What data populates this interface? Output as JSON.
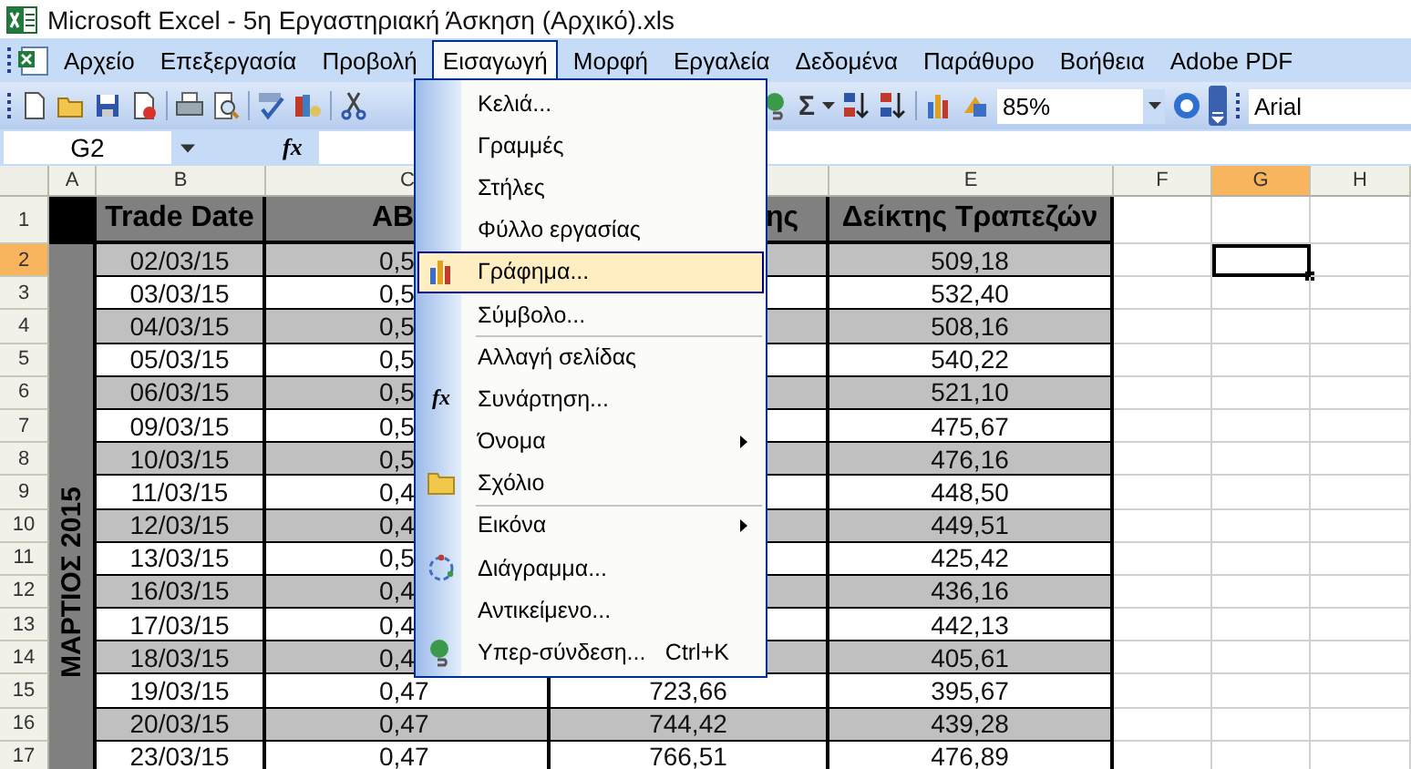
{
  "window": {
    "title": "Microsoft Excel - 5η Εργαστηριακή Άσκηση (Αρχικό).xls"
  },
  "menu_bar": [
    {
      "label": "Αρχείο",
      "selected": false
    },
    {
      "label": "Επεξεργασία",
      "selected": false
    },
    {
      "label": "Προβολή",
      "selected": false
    },
    {
      "label": "Εισαγωγή",
      "selected": true
    },
    {
      "label": "Μορφή",
      "selected": false
    },
    {
      "label": "Εργαλεία",
      "selected": false
    },
    {
      "label": "Δεδομένα",
      "selected": false
    },
    {
      "label": "Παράθυρο",
      "selected": false
    },
    {
      "label": "Βοήθεια",
      "selected": false
    },
    {
      "label": "Adobe PDF",
      "selected": false
    }
  ],
  "toolbar": {
    "sum_glyph": "Σ",
    "zoom": "85%",
    "font": "Arial"
  },
  "formula_bar": {
    "name_box": "G2",
    "function_glyph": "fx"
  },
  "insert_menu": [
    {
      "label": "Κελιά...",
      "kind": "plain",
      "selected": false,
      "separator_before": false,
      "submenu": false
    },
    {
      "label": "Γραμμές",
      "kind": "plain",
      "selected": false,
      "separator_before": false,
      "submenu": false
    },
    {
      "label": "Στήλες",
      "kind": "plain",
      "selected": false,
      "separator_before": false,
      "submenu": false
    },
    {
      "label": "Φύλλο εργασίας",
      "kind": "plain",
      "selected": false,
      "separator_before": false,
      "submenu": false
    },
    {
      "label": "Γράφημα...",
      "kind": "chart",
      "selected": true,
      "separator_before": false,
      "submenu": false
    },
    {
      "label": "Σύμβολο...",
      "kind": "plain",
      "selected": false,
      "separator_before": false,
      "submenu": false
    },
    {
      "label": "Αλλαγή σελίδας",
      "kind": "plain",
      "selected": false,
      "separator_before": true,
      "submenu": false
    },
    {
      "label": "Συνάρτηση...",
      "kind": "function",
      "glyph": "fx",
      "selected": false,
      "separator_before": false,
      "submenu": false
    },
    {
      "label": "Όνομα",
      "kind": "plain",
      "selected": false,
      "separator_before": false,
      "submenu": true
    },
    {
      "label": "Σχόλιο",
      "kind": "comment",
      "selected": false,
      "separator_before": false,
      "submenu": false
    },
    {
      "label": "Εικόνα",
      "kind": "plain",
      "selected": false,
      "separator_before": true,
      "submenu": true
    },
    {
      "label": "Διάγραμμα...",
      "kind": "diagram",
      "selected": false,
      "separator_before": false,
      "submenu": false
    },
    {
      "label": "Αντικείμενο...",
      "kind": "plain",
      "selected": false,
      "separator_before": false,
      "submenu": false
    },
    {
      "label": "Υπερ-σύνδεση...",
      "kind": "link",
      "shortcut": "Ctrl+K",
      "selected": false,
      "separator_before": false,
      "submenu": false
    }
  ],
  "sheet": {
    "columns": [
      {
        "label": "A",
        "selected": false
      },
      {
        "label": "B",
        "selected": false
      },
      {
        "label": "C",
        "selected": false
      },
      {
        "selected": false
      },
      {
        "label": "E",
        "selected": false
      },
      {
        "label": "F",
        "selected": false
      },
      {
        "label": "G",
        "selected": true
      },
      {
        "label": "H",
        "selected": false
      }
    ],
    "merged_label": "ΜΑΡΤΙΟΣ 2015",
    "header": {
      "row": "1",
      "trade_date": "Trade Date",
      "column_c": "ΑΒ",
      "column_d": "ης",
      "bank_index": "Δείκτης Τραπεζών"
    },
    "rows": [
      {
        "row": "2",
        "selected": true,
        "shaded": true,
        "trade_date": "02/03/15",
        "column_c": "0,5",
        "bank_index": "509,18"
      },
      {
        "row": "3",
        "selected": false,
        "shaded": false,
        "trade_date": "03/03/15",
        "column_c": "0,5",
        "bank_index": "532,40"
      },
      {
        "row": "4",
        "selected": false,
        "shaded": true,
        "trade_date": "04/03/15",
        "column_c": "0,5",
        "bank_index": "508,16"
      },
      {
        "row": "5",
        "selected": false,
        "shaded": false,
        "trade_date": "05/03/15",
        "column_c": "0,5",
        "bank_index": "540,22"
      },
      {
        "row": "6",
        "selected": false,
        "shaded": true,
        "trade_date": "06/03/15",
        "column_c": "0,5",
        "bank_index": "521,10"
      },
      {
        "row": "7",
        "selected": false,
        "shaded": false,
        "trade_date": "09/03/15",
        "column_c": "0,5",
        "bank_index": "475,67"
      },
      {
        "row": "8",
        "selected": false,
        "shaded": true,
        "trade_date": "10/03/15",
        "column_c": "0,5",
        "bank_index": "476,16"
      },
      {
        "row": "9",
        "selected": false,
        "shaded": false,
        "trade_date": "11/03/15",
        "column_c": "0,4",
        "bank_index": "448,50"
      },
      {
        "row": "10",
        "selected": false,
        "shaded": true,
        "trade_date": "12/03/15",
        "column_c": "0,4",
        "bank_index": "449,51"
      },
      {
        "row": "11",
        "selected": false,
        "shaded": false,
        "trade_date": "13/03/15",
        "column_c": "0,5",
        "bank_index": "425,42"
      },
      {
        "row": "12",
        "selected": false,
        "shaded": true,
        "trade_date": "16/03/15",
        "column_c": "0,4",
        "bank_index": "436,16"
      },
      {
        "row": "13",
        "selected": false,
        "shaded": false,
        "trade_date": "17/03/15",
        "column_c": "0,4",
        "bank_index": "442,13"
      },
      {
        "row": "14",
        "selected": false,
        "shaded": true,
        "trade_date": "18/03/15",
        "column_c": "0,4",
        "bank_index": "405,61"
      },
      {
        "row": "15",
        "selected": false,
        "shaded": false,
        "trade_date": "19/03/15",
        "column_c": "0,47",
        "column_d": "723,66",
        "bank_index": "395,67"
      },
      {
        "row": "16",
        "selected": false,
        "shaded": true,
        "trade_date": "20/03/15",
        "column_c": "0,47",
        "column_d": "744,42",
        "bank_index": "439,28"
      },
      {
        "row": "17",
        "selected": false,
        "shaded": false,
        "trade_date": "23/03/15",
        "column_c": "0,47",
        "column_d": "766,51",
        "bank_index": "476,89"
      }
    ]
  }
}
